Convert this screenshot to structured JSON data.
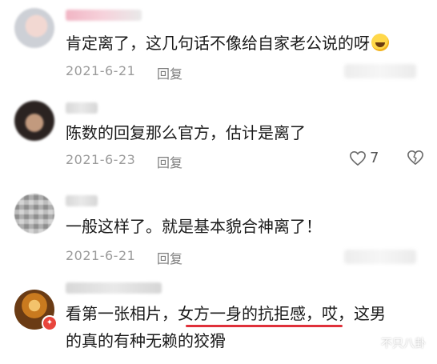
{
  "comments": [
    {
      "text": "肯定离了，这几句话不像给自家老公说的呀",
      "date": "2021-6-21",
      "reply": "回复"
    },
    {
      "text": "陈数的回复那么官方，估计是离了",
      "date": "2021-6-23",
      "reply": "回复",
      "likes": "7"
    },
    {
      "text": "一般这样了。就是基本貌合神离了！",
      "date": "2021-6-21",
      "reply": "回复"
    },
    {
      "line1_pre": "看第一张相片，",
      "line1_highlight": "女方一身的抗拒感，",
      "line1_post": "哎，这男",
      "line2": "的真的有种无赖的狡猾"
    }
  ],
  "watermark": "不只八卦",
  "colors": {
    "text": "#1a1a1a",
    "date": "#9b9b9b",
    "underline": "#e0303a"
  }
}
